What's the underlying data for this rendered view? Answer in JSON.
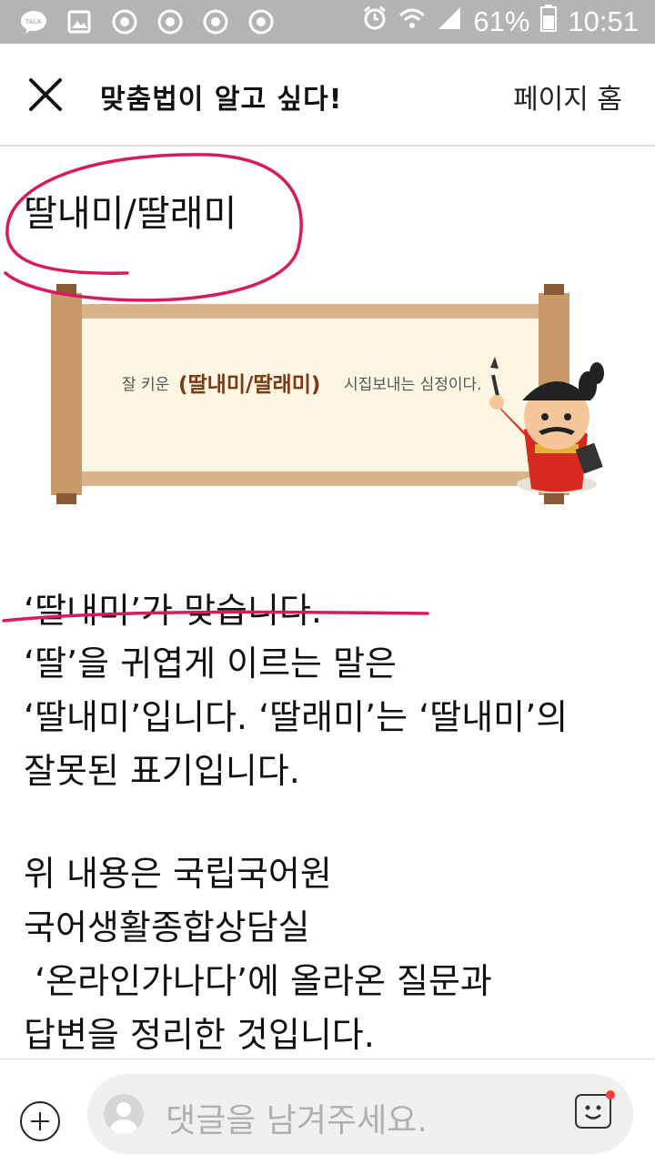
{
  "status_bar": {
    "battery": "61%",
    "time": "10:51",
    "left_icons": [
      "talk-icon",
      "gallery-icon",
      "chrome-icon",
      "chrome-icon",
      "chrome-icon",
      "chrome-icon"
    ],
    "right_icons": [
      "alarm-icon",
      "wifi-icon",
      "signal-icon",
      "battery-icon"
    ]
  },
  "header": {
    "close_icon": "close-icon",
    "title": "맞춤법이 알고 싶다!",
    "home_link": "페이지 홈"
  },
  "post": {
    "title": "딸내미/딸래미",
    "image_caption_pre": "잘 키운",
    "image_caption_word": "(딸내미/딸래미)",
    "image_caption_post": "시집보내는 심정이다.",
    "answer": "‘딸내미’가 맞습니다.",
    "explanation_lines": [
      "‘딸’을 귀엽게 이르는 말은",
      "‘딸내미’입니다. ‘딸래미’는 ‘딸내미’의",
      "잘못된 표기입니다."
    ],
    "source_lines": [
      "위 내용은 국립국어원",
      "국어생활종합상담실",
      " ‘온라인가나다’에 올라온 질문과",
      "답변을 정리한 것입니다."
    ]
  },
  "comment_bar": {
    "placeholder": "댓글을 남겨주세요.",
    "plus_icon": "plus-circle-icon",
    "emoji_icon": "emoji-icon"
  },
  "colors": {
    "status_bar": "#b4b4b4",
    "annotation": "#d81b60",
    "scroll_wood": "#c89a6a",
    "caption_highlight": "#7a3a14"
  }
}
